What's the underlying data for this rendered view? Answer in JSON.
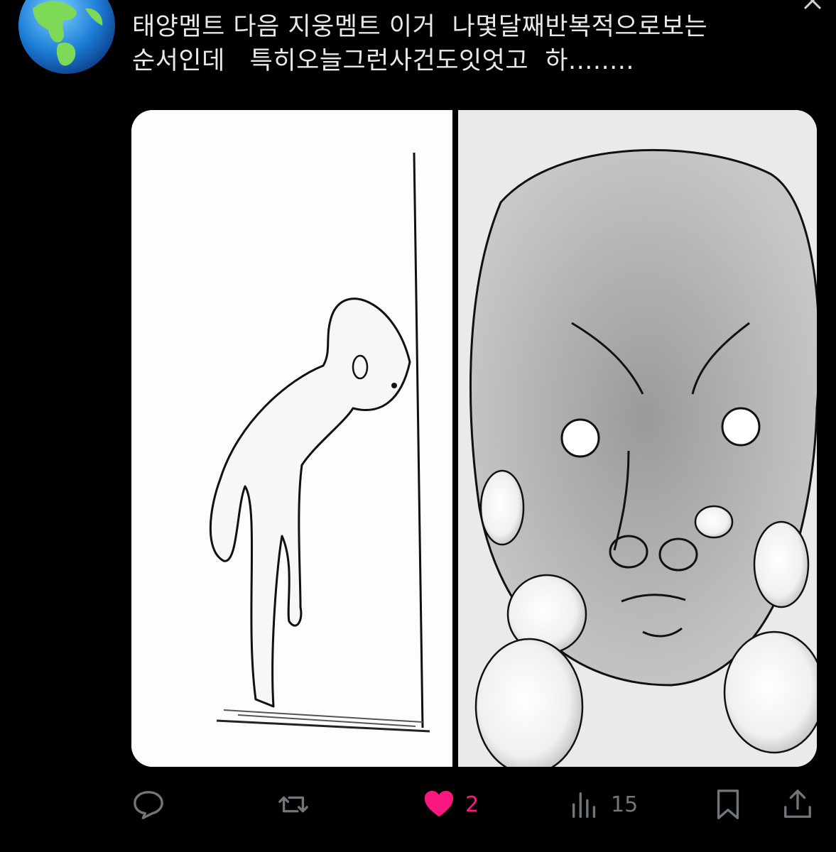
{
  "post": {
    "text": "태양멤트 다음 지웅멤트 이거  나몇달째반복적으로보는\n순서인데   특히오늘그런사건도잇엇고  하........",
    "media_alt": ""
  },
  "actions": {
    "reply_count": "",
    "repost_count": "",
    "like_count": "2",
    "views_count": "15",
    "liked": true
  },
  "colors": {
    "background": "#000000",
    "text": "#e7e9ea",
    "muted": "#71767b",
    "like": "#f91880"
  },
  "icons": {
    "avatar": "earth-globe-emoji",
    "close": "close-icon",
    "reply": "reply-icon",
    "repost": "repost-icon",
    "like": "heart-icon",
    "views": "views-icon",
    "bookmark": "bookmark-icon",
    "share": "share-icon"
  }
}
